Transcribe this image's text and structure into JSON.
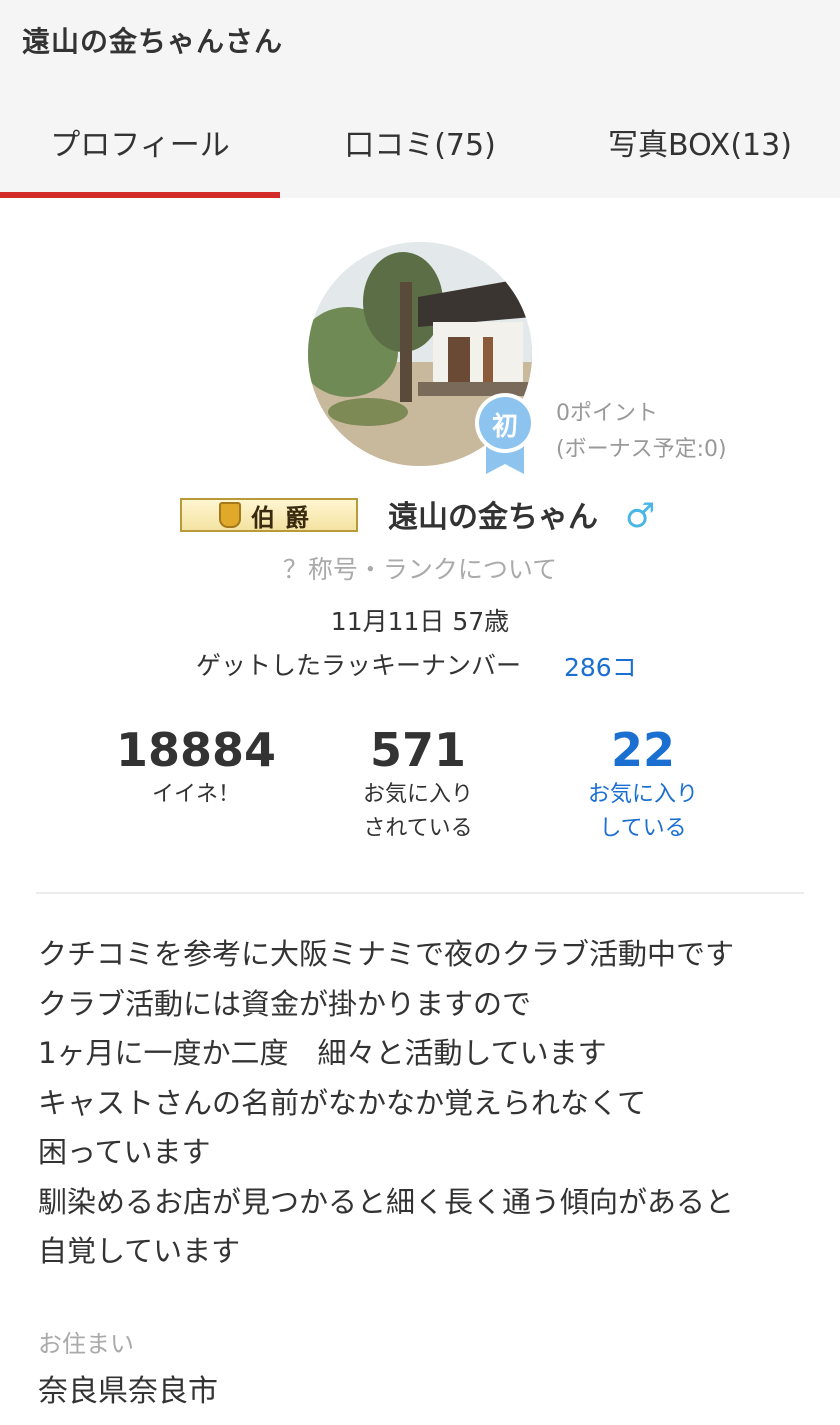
{
  "header": {
    "title": "遠山の金ちゃんさん",
    "tabs": [
      {
        "label": "プロフィール",
        "active": true
      },
      {
        "label": "口コミ(75)",
        "active": false
      },
      {
        "label": "写真BOX(13)",
        "active": false
      }
    ],
    "active_color": "#d32a2a"
  },
  "profile": {
    "badge_label": "初",
    "points": "0ポイント",
    "bonus": "(ボーナス予定:0)",
    "rank_title": "伯爵",
    "username": "遠山の金ちゃん",
    "gender_symbol": "♂",
    "rank_help_link": "？称号・ランクについて",
    "birth_age": "11月11日 57歳",
    "lucky_label": "ゲットしたラッキーナンバー",
    "lucky_value": "286コ"
  },
  "stats": [
    {
      "value": "18884",
      "label1": "イイネ！",
      "label2": ""
    },
    {
      "value": "571",
      "label1": "お気に入り",
      "label2": "されている"
    },
    {
      "value": "22",
      "label1": "お気に入り",
      "label2": "している"
    }
  ],
  "bio": {
    "lines": [
      "クチコミを参考に大阪ミナミで夜のクラブ活動中です",
      "クラブ活動には資金が掛かりますので",
      "1ヶ月に一度か二度　細々と活動しています",
      "キャストさんの名前がなかなか覚えられなくて",
      "困っています",
      "馴染めるお店が見つかると細く長く通う傾向があると",
      "自覚しています"
    ]
  },
  "residence": {
    "label": "お住まい",
    "value": "奈良県奈良市"
  },
  "colors": {
    "link_blue": "#1a6fd1",
    "gender_blue": "#49b6e5",
    "badge_blue": "#8cc4ef"
  }
}
